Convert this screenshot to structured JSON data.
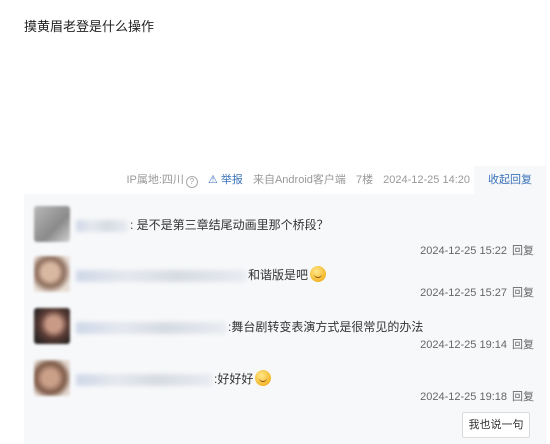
{
  "post": {
    "text": "摸黄眉老登是什么操作"
  },
  "meta": {
    "ip": "IP属地:四川",
    "report": "举报",
    "client": "来自Android客户端",
    "floor": "7楼",
    "time": "2024-12-25 14:20",
    "collapse": "收起回复"
  },
  "replies": [
    {
      "content": ": 是不是第三章结尾动画里那个桥段？",
      "time": "2024-12-25 15:22",
      "reply": "回复"
    },
    {
      "content": "和谐版是吧",
      "time": "2024-12-25 15:27",
      "reply": "回复"
    },
    {
      "content": ":舞台剧转变表演方式是很常见的办法",
      "time": "2024-12-25 19:14",
      "reply": "回复"
    },
    {
      "content": ":好好好",
      "time": "2024-12-25 19:18",
      "reply": "回复"
    }
  ],
  "say_button": "我也说一句"
}
